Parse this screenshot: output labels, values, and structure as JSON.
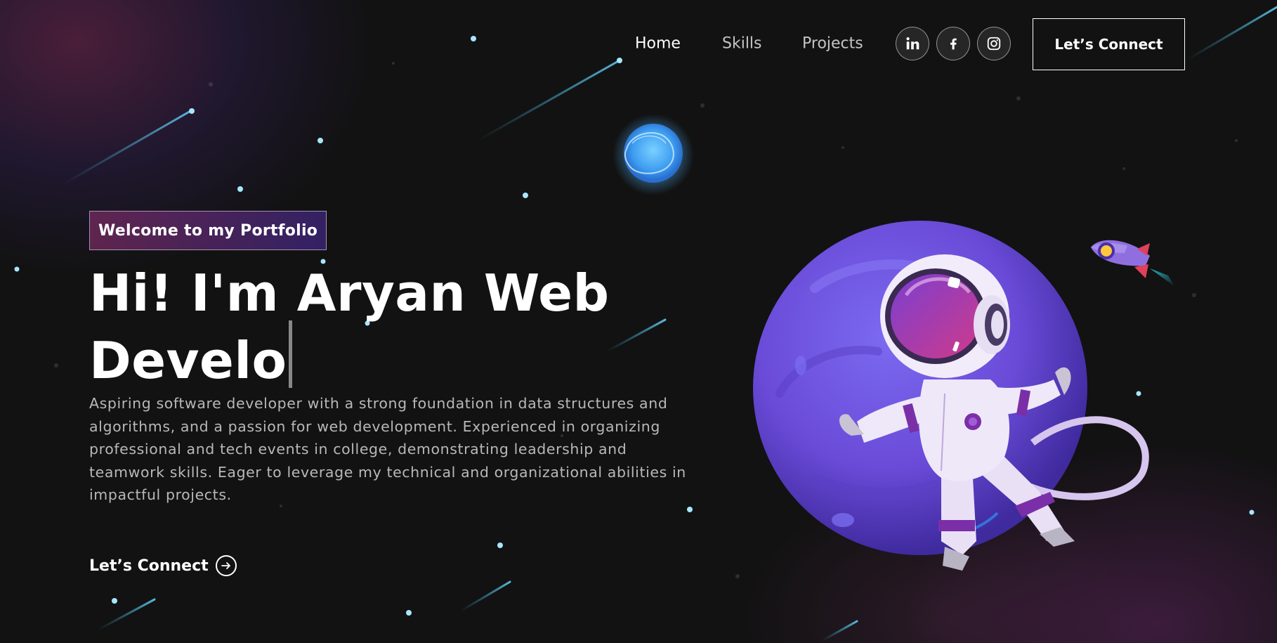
{
  "nav": {
    "links": [
      "Home",
      "Skills",
      "Projects"
    ],
    "social_icons": [
      "linkedin-icon",
      "facebook-icon",
      "instagram-icon"
    ],
    "connect_label": "Let’s Connect"
  },
  "hero": {
    "tagline": "Welcome to my Portfolio",
    "headline_line1": "Hi! I'm Aryan Web",
    "headline_line2": "Develo",
    "description": "Aspiring software developer with a strong foundation in data structures and algorithms, and a passion for web development. Experienced in organizing professional and tech events in college, demonstrating leadership and teamwork skills. Eager to leverage my technical and organizational abilities in impactful projects.",
    "cta_label": "Let’s Connect",
    "cta_icon": "arrow-right-circle-icon",
    "illustration": "astronaut-planet-illustration"
  },
  "colors": {
    "background": "#121212",
    "tagline_gradient_start": "#AA367C",
    "tagline_gradient_end": "#4A2FBD",
    "planet": "#6A4BD8",
    "glow_planet": "#4FB4FF",
    "text_muted": "#B8B8B8"
  }
}
